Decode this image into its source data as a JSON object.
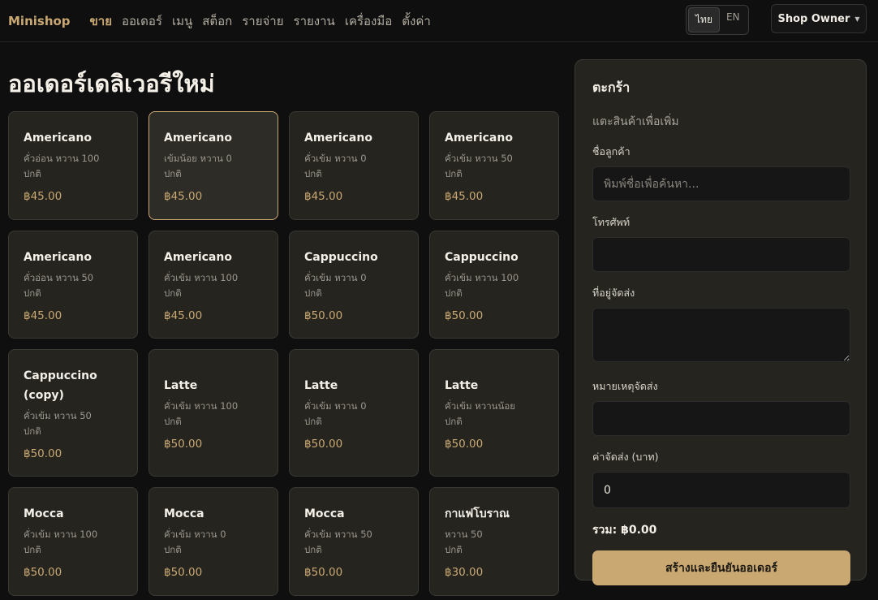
{
  "nav": {
    "brand": "Minishop",
    "links": [
      "ขาย",
      "ออเดอร์",
      "เมนู",
      "สต็อก",
      "รายจ่าย",
      "รายงาน",
      "เครื่องมือ",
      "ตั้งค่า"
    ],
    "lang": [
      "ไทย",
      "EN"
    ],
    "user": "Shop Owner"
  },
  "page": {
    "title": "ออเดอร์เดลิเวอรีใหม่"
  },
  "products": [
    {
      "name": "Americano",
      "desc1": "คั่วอ่อน หวาน 100",
      "desc2": "ปกติ",
      "price": "฿45.00"
    },
    {
      "name": "Americano",
      "desc1": "เข้มน้อย หวาน 0",
      "desc2": "ปกติ",
      "price": "฿45.00"
    },
    {
      "name": "Americano",
      "desc1": "คั่วเข้ม หวาน 0",
      "desc2": "ปกติ",
      "price": "฿45.00"
    },
    {
      "name": "Americano",
      "desc1": "คั่วเข้ม หวาน 50",
      "desc2": "ปกติ",
      "price": "฿45.00"
    },
    {
      "name": "Americano",
      "desc1": "คั่วอ่อน หวาน 50",
      "desc2": "ปกติ",
      "price": "฿45.00"
    },
    {
      "name": "Americano",
      "desc1": "คั่วเข้ม หวาน 100",
      "desc2": "ปกติ",
      "price": "฿45.00"
    },
    {
      "name": "Cappuccino",
      "desc1": "คั่วเข้ม หวาน 0",
      "desc2": "ปกติ",
      "price": "฿50.00"
    },
    {
      "name": "Cappuccino",
      "desc1": "คั่วเข้ม หวาน 100",
      "desc2": "ปกติ",
      "price": "฿50.00"
    },
    {
      "name": "Cappuccino (copy)",
      "desc1": "คั่วเข้ม หวาน 50",
      "desc2": "ปกติ",
      "price": "฿50.00"
    },
    {
      "name": "Latte",
      "desc1": "คั่วเข้ม หวาน 100",
      "desc2": "ปกติ",
      "price": "฿50.00"
    },
    {
      "name": "Latte",
      "desc1": "คั่วเข้ม หวาน 0",
      "desc2": "ปกติ",
      "price": "฿50.00"
    },
    {
      "name": "Latte",
      "desc1": "คั่วเข้ม หวานน้อย",
      "desc2": "ปกติ",
      "price": "฿50.00"
    },
    {
      "name": "Mocca",
      "desc1": "คั่วเข้ม หวาน 100",
      "desc2": "ปกติ",
      "price": "฿50.00"
    },
    {
      "name": "Mocca",
      "desc1": "คั่วเข้ม หวาน 0",
      "desc2": "ปกติ",
      "price": "฿50.00"
    },
    {
      "name": "Mocca",
      "desc1": "คั่วเข้ม หวาน 50",
      "desc2": "ปกติ",
      "price": "฿50.00"
    },
    {
      "name": "กาแฟโบราณ",
      "desc1": "หวาน 50",
      "desc2": "ปกติ",
      "price": "฿30.00"
    }
  ],
  "cart": {
    "title": "ตะกร้า",
    "hint": "แตะสินค้าเพื่อเพิ่ม",
    "customer_label": "ชื่อลูกค้า",
    "customer_placeholder": "พิมพ์ชื่อเพื่อค้นหา...",
    "phone_label": "โทรศัพท์",
    "address_label": "ที่อยู่จัดส่ง",
    "note_label": "หมายเหตุจัดส่ง",
    "fee_label": "ค่าจัดส่ง (บาท)",
    "fee_value": "0",
    "total": "รวม: ฿0.00",
    "submit": "สร้างและยืนยันออเดอร์"
  },
  "colors": {
    "accent": "#c9a872",
    "background": "#0f0f0f",
    "card": "#25241f"
  }
}
